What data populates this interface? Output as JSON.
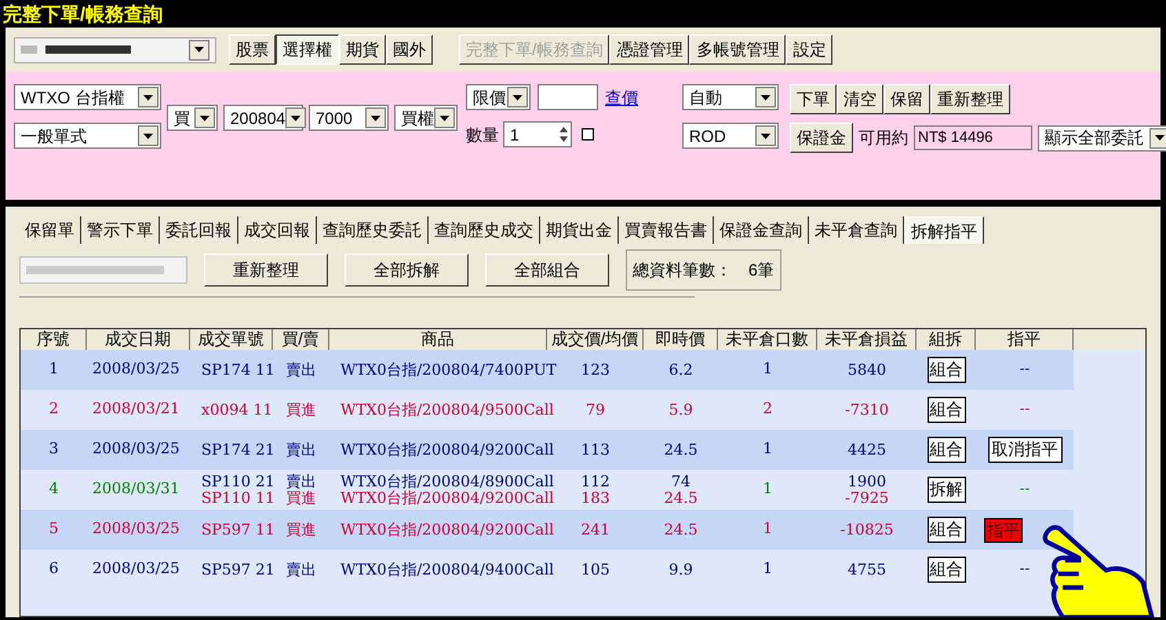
{
  "window": {
    "title": "完整下單/帳務查詢"
  },
  "toolbar": {
    "market_tabs": [
      {
        "label": "股票",
        "selected": false
      },
      {
        "label": "選擇權",
        "selected": true
      },
      {
        "label": "期貨",
        "selected": false
      },
      {
        "label": "國外",
        "selected": false
      }
    ],
    "buttons": [
      {
        "label": "完整下單/帳務查詢",
        "disabled": true
      },
      {
        "label": "憑證管理",
        "disabled": false
      },
      {
        "label": "多帳號管理",
        "disabled": false
      },
      {
        "label": "設定",
        "disabled": false
      }
    ]
  },
  "order": {
    "contract": "WTXO 台指權",
    "order_type": "一般單式",
    "side": "買",
    "month": "200804",
    "strike": "7000",
    "call_put": "買權",
    "price_type": "限價",
    "quote_link": "查價",
    "auto": "自動",
    "qty_label": "數量",
    "qty": "1",
    "confirm_checked": false,
    "tif": "ROD",
    "buttons": [
      "下單",
      "清空",
      "保留",
      "重新整理"
    ],
    "margin_button": "保證金",
    "available_label": "可用約",
    "available": "NT$ 14496",
    "filter": "顯示全部委託"
  },
  "tabs": [
    {
      "label": "保留單",
      "selected": false
    },
    {
      "label": "警示下單",
      "selected": false
    },
    {
      "label": "委託回報",
      "selected": false
    },
    {
      "label": "成交回報",
      "selected": false
    },
    {
      "label": "查詢歷史委託",
      "selected": false
    },
    {
      "label": "查詢歷史成交",
      "selected": false
    },
    {
      "label": "期貨出金",
      "selected": false
    },
    {
      "label": "買賣報告書",
      "selected": false
    },
    {
      "label": "保證金查詢",
      "selected": false
    },
    {
      "label": "未平倉查詢",
      "selected": false
    },
    {
      "label": "拆解指平",
      "selected": true
    }
  ],
  "actions": [
    "重新整理",
    "全部拆解",
    "全部組合"
  ],
  "total": {
    "label": "總資料筆數：",
    "value": "6筆"
  },
  "table": {
    "columns": [
      "序號",
      "成交日期",
      "成交單號",
      "買/賣",
      "商品",
      "成交價/均價",
      "即時價",
      "未平倉口數",
      "未平倉損益",
      "組拆",
      "指平"
    ],
    "rows": [
      {
        "no": "1",
        "date": "2008/03/25",
        "color": "#000080",
        "legs": [
          {
            "order_no": "SP174 11",
            "side": "賣出",
            "product": "WTX0台指/200804/7400PUT",
            "price": "123",
            "last": "6.2",
            "pnl": "5840",
            "color": "#000080"
          }
        ],
        "open_qty": "1",
        "combine": "組合",
        "close": {
          "kind": "text",
          "label": "--"
        }
      },
      {
        "no": "2",
        "date": "2008/03/21",
        "color": "#cc0033",
        "legs": [
          {
            "order_no": "x0094 11",
            "side": "買進",
            "product": "WTX0台指/200804/9500Call",
            "price": "79",
            "last": "5.9",
            "pnl": "-7310",
            "color": "#cc0033"
          }
        ],
        "open_qty": "2",
        "combine": "組合",
        "close": {
          "kind": "text",
          "label": "--"
        }
      },
      {
        "no": "3",
        "date": "2008/03/25",
        "color": "#000080",
        "legs": [
          {
            "order_no": "SP174 21",
            "side": "賣出",
            "product": "WTX0台指/200804/9200Call",
            "price": "113",
            "last": "24.5",
            "pnl": "4425",
            "color": "#000080"
          }
        ],
        "open_qty": "1",
        "combine": "組合",
        "close": {
          "kind": "button",
          "label": "取消指平"
        }
      },
      {
        "no": "4",
        "date": "2008/03/31",
        "color": "#008000",
        "legs": [
          {
            "order_no": "SP110 21",
            "side": "賣出",
            "product": "WTX0台指/200804/8900Call",
            "price": "112",
            "last": "74",
            "pnl": "1900",
            "color": "#000080"
          },
          {
            "order_no": "SP110 11",
            "side": "買進",
            "product": "WTX0台指/200804/9200Call",
            "price": "183",
            "last": "24.5",
            "pnl": "-7925",
            "color": "#cc0033"
          }
        ],
        "open_qty": "1",
        "combine": "拆解",
        "close": {
          "kind": "text",
          "label": "--"
        }
      },
      {
        "no": "5",
        "date": "2008/03/25",
        "color": "#cc0033",
        "legs": [
          {
            "order_no": "SP597 11",
            "side": "買進",
            "product": "WTX0台指/200804/9200Call",
            "price": "241",
            "last": "24.5",
            "pnl": "-10825",
            "color": "#cc0033"
          }
        ],
        "open_qty": "1",
        "combine": "組合",
        "close": {
          "kind": "highlight",
          "label": "指平"
        }
      },
      {
        "no": "6",
        "date": "2008/03/25",
        "color": "#000080",
        "legs": [
          {
            "order_no": "SP597 21",
            "side": "賣出",
            "product": "WTX0台指/200804/9400Call",
            "price": "105",
            "last": "9.9",
            "pnl": "4755",
            "color": "#000080"
          }
        ],
        "open_qty": "1",
        "combine": "組合",
        "close": {
          "kind": "text",
          "label": "--"
        }
      }
    ]
  }
}
